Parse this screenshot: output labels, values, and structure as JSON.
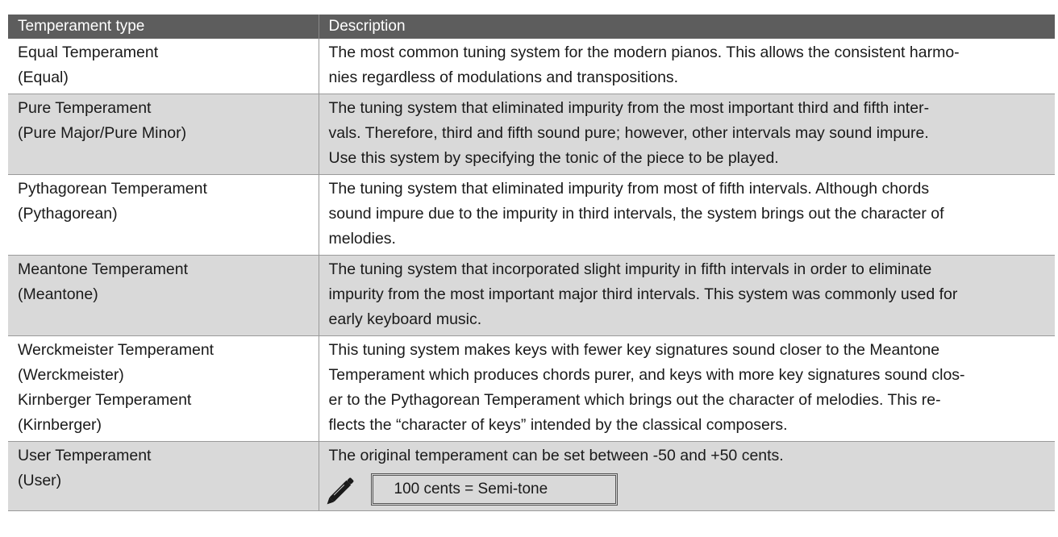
{
  "table": {
    "headers": [
      "Temperament type",
      "Description"
    ],
    "rows": [
      {
        "type_lines": [
          "Equal Temperament",
          "(Equal)"
        ],
        "desc_lines": [
          "The most common tuning system for the modern pianos. This allows the consistent harmo-",
          "nies regardless of modulations and transpositions."
        ]
      },
      {
        "type_lines": [
          "Pure Temperament",
          "(Pure Major/Pure Minor)"
        ],
        "desc_lines": [
          "The tuning system that eliminated impurity from the most important third and fifth inter-",
          "vals. Therefore, third and fifth sound pure; however, other intervals may sound impure.",
          "Use this system by specifying the tonic of the piece to be played."
        ]
      },
      {
        "type_lines": [
          "Pythagorean Temperament",
          "(Pythagorean)"
        ],
        "desc_lines": [
          "The tuning system that eliminated impurity from most of fifth intervals. Although chords",
          "sound impure due to the impurity in third intervals, the system brings out the character of",
          "melodies."
        ]
      },
      {
        "type_lines": [
          "Meantone Temperament",
          "(Meantone)"
        ],
        "desc_lines": [
          "The tuning system that incorporated slight impurity in fifth intervals in order to eliminate",
          "impurity from the most important major third intervals. This system was commonly used for",
          "early keyboard music."
        ]
      },
      {
        "type_lines": [
          "Werckmeister Temperament",
          "(Werckmeister)",
          "Kirnberger Temperament",
          "(Kirnberger)"
        ],
        "desc_lines": [
          "This tuning system makes keys with fewer key signatures sound closer to the Meantone",
          "Temperament which produces chords purer, and keys with more key signatures sound clos-",
          "er to the Pythagorean Temperament which brings out the character of melodies. This re-",
          "flects the “character of keys” intended by the classical composers."
        ]
      },
      {
        "type_lines": [
          "User Temperament",
          "(User)"
        ],
        "desc_lines": [
          "The original temperament can be set between -50 and +50 cents."
        ],
        "note": "100 cents = Semi-tone"
      }
    ]
  },
  "icons": {
    "note": "pencil-icon"
  },
  "colors": {
    "header_bg": "#5d5d5d",
    "row_gray": "#d9d9d9",
    "row_white": "#ffffff"
  }
}
